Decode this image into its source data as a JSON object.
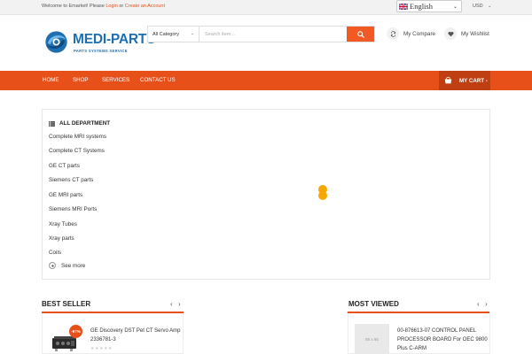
{
  "topbar": {
    "welcome_prefix": "Welcome to Emarket! Please ",
    "login_label": "Login",
    "or_label": " or ",
    "create_account_label": "Create an Account",
    "language": "English",
    "currency": "USD"
  },
  "header": {
    "logo_name": "MEDI-PARTS",
    "logo_tagline": "PARTS SYSTEMS SERVICE",
    "search_category": "All Category",
    "search_placeholder": "Search item...",
    "compare_label": "My Compare",
    "wishlist_label": "My Wishlist"
  },
  "nav": {
    "items": [
      "HOME",
      "SHOP",
      "SERVICES",
      "CONTACT US"
    ],
    "cart_label": "MY CART -"
  },
  "departments": {
    "title": "ALL DEPARTMENT",
    "items": [
      "Complete MRI systems",
      "Complete CT Systems",
      "GE CT parts",
      "Siemens CT parts",
      "GE MRI parts",
      "Siemens MRI Ports",
      "Xray Tubes",
      "Xray parts",
      "Coils"
    ],
    "see_more_label": "See more"
  },
  "best_seller": {
    "title": "BEST SELLER",
    "product": {
      "name": "GE Discovery DST Pet CT Servo Amp 2336781-3",
      "discount": "-67%",
      "rating": "★★★★★"
    }
  },
  "most_viewed": {
    "title": "MOST VIEWED",
    "product": {
      "name": "00-876613-07 CONTROL PANEL PROCESSOR BOARD For OEC 9800 Plus C-ARM",
      "image_placeholder": "85 x 85"
    }
  },
  "colors": {
    "accent": "#e8501a",
    "search_button": "#f15a24",
    "cart_background": "#bf3f12",
    "logo_blue": "#1f6fb0",
    "loader": "#f7a800"
  }
}
